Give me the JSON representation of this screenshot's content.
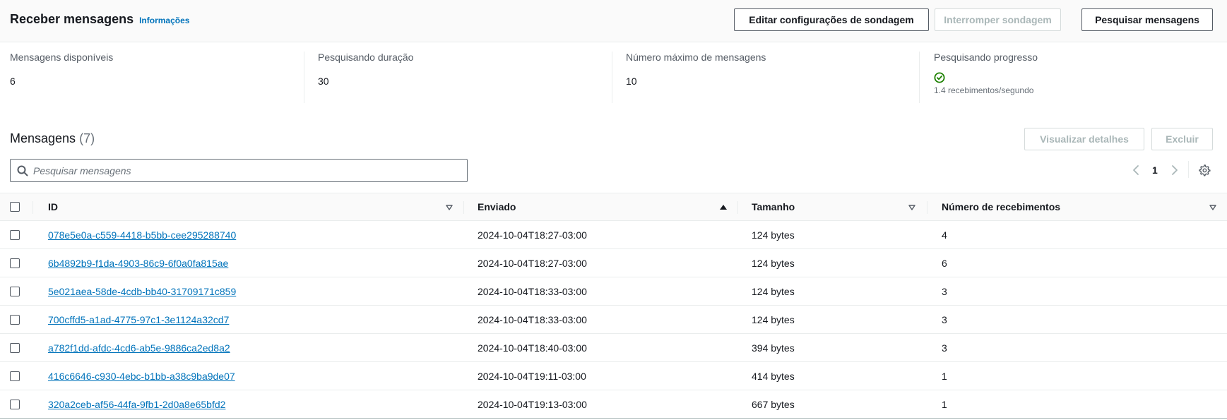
{
  "header": {
    "title": "Receber mensagens",
    "info_label": "Informações",
    "buttons": {
      "edit_label": "Editar configurações de sondagem",
      "stop_label": "Interromper sondagem",
      "poll_label": "Pesquisar mensagens"
    }
  },
  "stats": {
    "available": {
      "label": "Mensagens disponíveis",
      "value": "6"
    },
    "duration": {
      "label": "Pesquisando duração",
      "value": "30"
    },
    "max_messages": {
      "label": "Número máximo de mensagens",
      "value": "10"
    },
    "progress": {
      "label": "Pesquisando progresso",
      "rate": "1.4 recebimentos/segundo",
      "status_icon": "check-circle-icon"
    }
  },
  "messages": {
    "title": "Mensagens",
    "count": "(7)",
    "view_details_label": "Visualizar detalhes",
    "delete_label": "Excluir",
    "search_placeholder": "Pesquisar mensagens",
    "page": "1",
    "columns": {
      "id": "ID",
      "sent": "Enviado",
      "size": "Tamanho",
      "receive_count": "Número de recebimentos"
    },
    "sort": {
      "column": "sent",
      "direction": "ascending"
    },
    "rows": [
      {
        "id": "078e5e0a-c559-4418-b5bb-cee295288740",
        "sent": "2024-10-04T18:27-03:00",
        "size": "124 bytes",
        "receive_count": "4"
      },
      {
        "id": "6b4892b9-f1da-4903-86c9-6f0a0fa815ae",
        "sent": "2024-10-04T18:27-03:00",
        "size": "124 bytes",
        "receive_count": "6"
      },
      {
        "id": "5e021aea-58de-4cdb-bb40-31709171c859",
        "sent": "2024-10-04T18:33-03:00",
        "size": "124 bytes",
        "receive_count": "3"
      },
      {
        "id": "700cffd5-a1ad-4775-97c1-3e1124a32cd7",
        "sent": "2024-10-04T18:33-03:00",
        "size": "124 bytes",
        "receive_count": "3"
      },
      {
        "id": "a782f1dd-afdc-4cd6-ab5e-9886ca2ed8a2",
        "sent": "2024-10-04T18:40-03:00",
        "size": "394 bytes",
        "receive_count": "3"
      },
      {
        "id": "416c6646-c930-4ebc-b1bb-a38c9ba9de07",
        "sent": "2024-10-04T19:11-03:00",
        "size": "414 bytes",
        "receive_count": "1"
      },
      {
        "id": "320a2ceb-af56-44fa-9fb1-2d0a8e65bfd2",
        "sent": "2024-10-04T19:13-03:00",
        "size": "667 bytes",
        "receive_count": "1"
      }
    ]
  },
  "colors": {
    "link": "#0073bb",
    "success": "#1d8102",
    "border": "#eaeded"
  }
}
